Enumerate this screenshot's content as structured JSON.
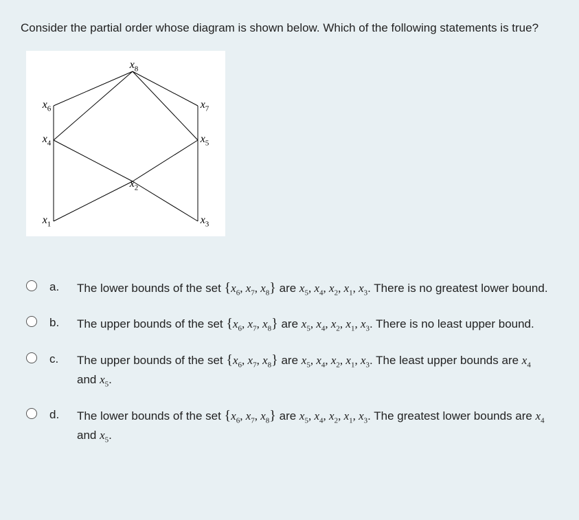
{
  "question": "Consider the partial order whose diagram is shown below. Which of the following statements is true?",
  "diagram": {
    "labels": {
      "x8": "x8",
      "x6": "x6",
      "x7": "x7",
      "x4": "x4",
      "x5": "x5",
      "x2": "x2",
      "x1": "x1",
      "x3": "x3"
    }
  },
  "chart_data": {
    "type": "diagram",
    "description": "Hasse diagram of a partial order with 8 elements (x1..x8)",
    "nodes": [
      "x1",
      "x2",
      "x3",
      "x4",
      "x5",
      "x6",
      "x7",
      "x8"
    ],
    "edges": [
      [
        "x1",
        "x4"
      ],
      [
        "x1",
        "x2"
      ],
      [
        "x3",
        "x2"
      ],
      [
        "x3",
        "x5"
      ],
      [
        "x2",
        "x4"
      ],
      [
        "x2",
        "x5"
      ],
      [
        "x4",
        "x6"
      ],
      [
        "x4",
        "x8"
      ],
      [
        "x5",
        "x7"
      ],
      [
        "x5",
        "x8"
      ],
      [
        "x6",
        "x8"
      ],
      [
        "x7",
        "x8"
      ]
    ],
    "levels": {
      "0": [
        "x1",
        "x3"
      ],
      "1": [
        "x2"
      ],
      "2": [
        "x4",
        "x5"
      ],
      "3": [
        "x6",
        "x7"
      ],
      "4": [
        "x8"
      ]
    }
  },
  "set_string": "{x₆, x₇, x₈}",
  "list_string": "x₅, x₄, x₂, x₁, x₃",
  "options": {
    "a": {
      "letter": "a.",
      "prefix": "The lower bounds of the set ",
      "mid": " are ",
      "tail": ". There is no greatest lower bound."
    },
    "b": {
      "letter": "b.",
      "prefix": "The upper bounds of the set ",
      "mid": " are ",
      "tail": ". There is no least upper bound."
    },
    "c": {
      "letter": "c.",
      "prefix": "The upper bounds of the set ",
      "mid": " are ",
      "tail1": ". The least upper bounds are ",
      "and": " and ",
      "period": "."
    },
    "d": {
      "letter": "d.",
      "prefix": "The lower bounds of the set ",
      "mid": " are ",
      "tail1": ". The greatest lower bounds are ",
      "and": " and ",
      "period": "."
    }
  },
  "tail_vars": {
    "x4": "x4",
    "x5": "x5"
  }
}
